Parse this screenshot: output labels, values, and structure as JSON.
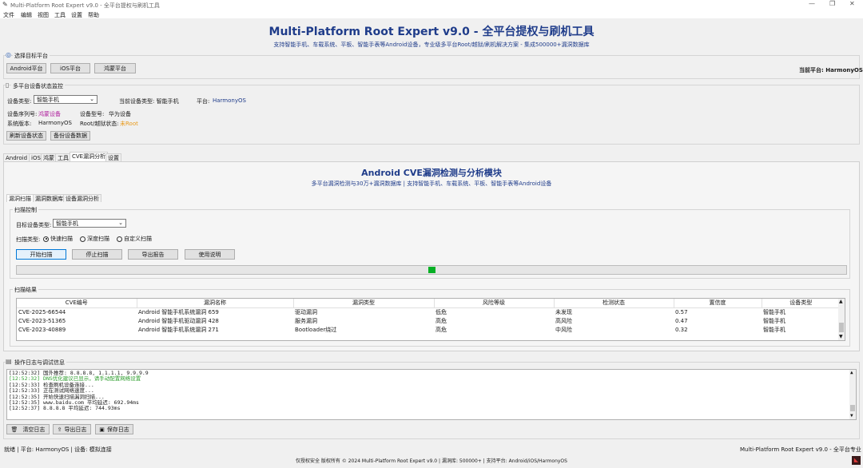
{
  "window": {
    "title": "Multi-Platform Root Expert v9.0 - 全平台提权与刷机工具",
    "menu": [
      "文件",
      "编辑",
      "视图",
      "工具",
      "设置",
      "帮助"
    ]
  },
  "header": {
    "title": "Multi-Platform Root Expert v9.0 - 全平台提权与刷机工具",
    "subtitle": "支持智能手机、车载系统、平板、智能手表等Android设备，专业级多平台Root/越狱/刷机解决方案 - 集成500000+漏洞数据库"
  },
  "platform_select": {
    "title": "选择目标平台",
    "buttons": [
      "Android平台",
      "iOS平台",
      "鸿蒙平台"
    ],
    "current": "当前平台: HarmonyOS"
  },
  "device_monitor": {
    "title": "多平台设备状态监控",
    "type_label": "设备类型:",
    "type_value": "智能手机",
    "current_type": "当前设备类型: 智能手机",
    "platform_label": "平台:",
    "platform_value": "HarmonyOS",
    "serial_label": "设备序列号:",
    "serial_value": "鸿蒙设备",
    "model_label": "设备型号:",
    "model_value": "华为设备",
    "version_label": "系统版本:",
    "version_value": "HarmonyOS",
    "root_label": "Root/越狱状态:",
    "root_value": "未Root",
    "refresh_btn": "刷新设备状态",
    "backup_btn": "备份设备数据"
  },
  "main_tabs": [
    "Android",
    "iOS",
    "鸿蒙",
    "工具",
    "CVE漏洞分析",
    "设置"
  ],
  "cve": {
    "title": "Android CVE漏洞检测与分析模块",
    "subtitle": "多平台漏洞检测与30万+漏洞数据库 | 支持智能手机、车载系统、平板、智能手表等Android设备",
    "sub_tabs": [
      "漏洞扫描",
      "漏洞数据库",
      "设备漏洞分析"
    ],
    "scan_control": "扫描控制",
    "target_label": "目标设备类型:",
    "target_value": "智能手机",
    "scan_type_label": "扫描类型:",
    "scan_types": [
      "快速扫描",
      "深度扫描",
      "自定义扫描"
    ],
    "buttons": [
      "开始扫描",
      "停止扫描",
      "导出报告",
      "使用说明"
    ],
    "progress": 0.5,
    "results_title": "扫描结果",
    "columns": [
      "CVE编号",
      "漏洞名称",
      "漏洞类型",
      "风险等级",
      "检测状态",
      "置信度",
      "设备类型"
    ],
    "rows": [
      [
        "CVE-2025-66544",
        "Android 智能手机系统漏洞 659",
        "驱动漏洞",
        "低危",
        "未发现",
        "0.57",
        "智能手机"
      ],
      [
        "CVE-2023-51365",
        "Android 智能手机驱动漏洞 428",
        "服务漏洞",
        "高危",
        "高风险",
        "0.47",
        "智能手机"
      ],
      [
        "CVE-2023-40889",
        "Android 智能手机系统漏洞 271",
        "Bootloader绕过",
        "高危",
        "中风险",
        "0.32",
        "智能手机"
      ]
    ]
  },
  "log": {
    "title": "操作日志与调试信息",
    "lines": [
      {
        "text": "[12:52:32] 国外推荐: 8.8.8.8, 1.1.1.1, 9.9.9.9",
        "color": "#1a1a1a"
      },
      {
        "text": "[12:52:32] DNS优化建议已显示，请手动配置网络设置",
        "color": "#2e9e2e"
      },
      {
        "text": "[12:52:33] 检查刷机设备连接...",
        "color": "#1a1a1a"
      },
      {
        "text": "[12:52:33] 正在测试网络速度...",
        "color": "#1a1a1a"
      },
      {
        "text": "[12:52:35] 开始快速扫描漏洞扫描...",
        "color": "#1a1a1a"
      },
      {
        "text": "[12:52:35] www.baidu.com 平均延迟: 692.94ms",
        "color": "#1a1a1a"
      },
      {
        "text": "[12:52:37] 8.8.8.8 平均延迟: 744.93ms",
        "color": "#1a1a1a"
      }
    ],
    "buttons": [
      "清空日志",
      "导出日志",
      "保存日志"
    ]
  },
  "status": {
    "left": "就绪 | 平台: HarmonyOS | 设备: 模拟连接",
    "right": "Multi-Platform Root Expert v9.0 - 全平台专业",
    "footer": "仅授权安全 版权所有 © 2024 Multi-Platform Root Expert v9.0 | 漏洞库: 500000+ | 支持平台: Android/iOS/HarmonyOS"
  },
  "colors": {
    "title_blue": "#1f3c8a",
    "progress_green": "#06b025",
    "root_orange": "#e89a1c",
    "serial_magenta": "#b0229e"
  }
}
